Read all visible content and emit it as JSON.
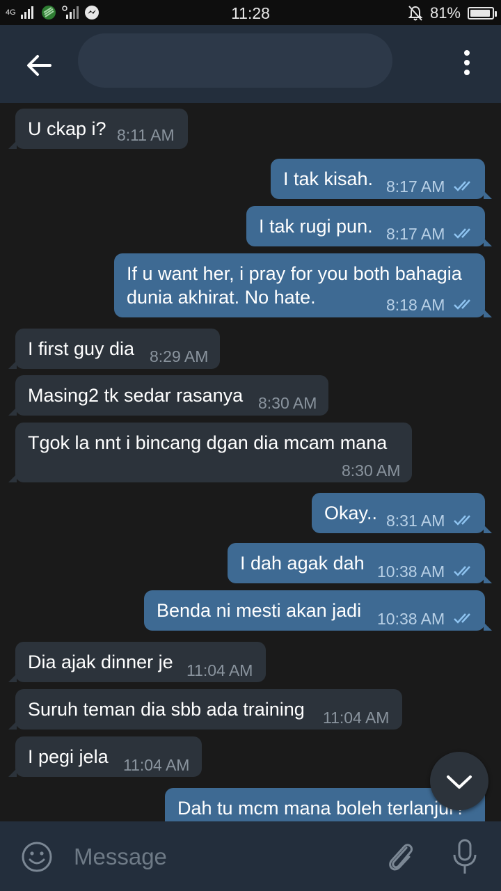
{
  "status_bar": {
    "network": "4G",
    "time": "11:28",
    "battery": "81%",
    "battery_level": 0.81
  },
  "header": {
    "back_icon": "arrow-left-icon",
    "more_icon": "more-vertical-icon"
  },
  "messages": [
    {
      "dir": "in",
      "text": "U ckap i?",
      "time": "8:11 AM"
    },
    {
      "dir": "out",
      "text": "I tak kisah.",
      "time": "8:17 AM"
    },
    {
      "dir": "out",
      "text": "I tak rugi pun.",
      "time": "8:17 AM"
    },
    {
      "dir": "out",
      "text": "If u want her, i pray for you both bahagia",
      "text2": "dunia akhirat. No hate.",
      "time": "8:18 AM"
    },
    {
      "dir": "in",
      "text": "I first guy dia",
      "time": "8:29 AM"
    },
    {
      "dir": "in",
      "text": "Masing2 tk sedar rasanya",
      "time": "8:30 AM"
    },
    {
      "dir": "in",
      "text": "Tgok la nnt i bincang dgan dia mcam mana",
      "time": "8:30 AM"
    },
    {
      "dir": "out",
      "text": "Okay..",
      "time": "8:31 AM"
    },
    {
      "dir": "out",
      "text": "I dah agak dah",
      "time": "10:38 AM"
    },
    {
      "dir": "out",
      "text": "Benda ni mesti akan jadi",
      "time": "10:38 AM"
    },
    {
      "dir": "in",
      "text": "Dia ajak dinner je",
      "time": "11:04 AM"
    },
    {
      "dir": "in",
      "text": "Suruh teman dia sbb ada training",
      "time": "11:04 AM"
    },
    {
      "dir": "in",
      "text": "I pegi jela",
      "time": "11:04 AM"
    },
    {
      "dir": "out",
      "text": "Dah tu mcm mana boleh terlanjur?",
      "time": ""
    }
  ],
  "input": {
    "placeholder": "Message",
    "value": ""
  },
  "colors": {
    "incoming_bubble": "#2c333b",
    "outgoing_bubble": "#3e6a93",
    "read_ticks": "#8ec3f0"
  }
}
